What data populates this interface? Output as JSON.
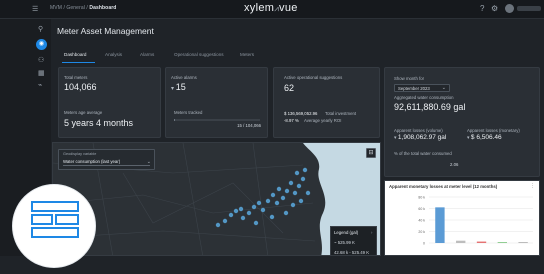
{
  "topbar": {
    "menu_icon": "hamburger-icon",
    "breadcrumb": {
      "prefix": "MVM / General / ",
      "current": "Dashboard"
    },
    "brand": {
      "left": "xylem",
      "right": "vue"
    },
    "icons": [
      "help-icon",
      "gear-icon",
      "user-avatar-icon"
    ]
  },
  "sidebar": {
    "items": [
      {
        "icon": "location-pin-icon"
      },
      {
        "icon": "dashboard-icon",
        "active": true
      },
      {
        "icon": "users-icon"
      },
      {
        "icon": "grid-icon"
      },
      {
        "icon": "analytics-icon"
      }
    ]
  },
  "page": {
    "title": "Meter Asset Management"
  },
  "tabs": [
    {
      "label": "Dashboard",
      "active": true
    },
    {
      "label": "Analysis"
    },
    {
      "label": "Alarms"
    },
    {
      "label": "Operational suggestions"
    },
    {
      "label": "Meters"
    }
  ],
  "cards": {
    "meters": {
      "total_label": "Total meters",
      "total_value": "104,066",
      "age_label": "Meters age average",
      "age_value": "5 years 4 months"
    },
    "alarms": {
      "label": "Active alarms",
      "value": "15",
      "tracked_label": "Meters tracked",
      "tracked_value": "15 / 104,066",
      "tracked_fraction": 0.00014
    },
    "suggestions": {
      "label": "Active operational suggestions",
      "value": "62",
      "investment_value": "$ 136,569,052.96",
      "investment_label": "Total investment",
      "roi_value": "-8.97 %",
      "roi_label": "Average yearly ROI"
    },
    "consumption": {
      "month_label": "Show month for",
      "month_value": "September 2023",
      "aggregated_label": "Aggregated water consumption",
      "aggregated_value": "92,611,880.69 gal",
      "losses_volume_label": "Apparent losses (volume)",
      "losses_volume_value": "1,908,062.97 gal",
      "losses_money_label": "Apparent losses (monetary)",
      "losses_money_value": "$ 6,506.46",
      "pct_label": "% of the total water consumed",
      "pct_value": "2.06"
    }
  },
  "map": {
    "layer_label": "Geodisplay variable",
    "layer_value": "Water consumption (last year)",
    "legend_title": "Legend (gal)",
    "legend_items": [
      "~ 525.99 K",
      "42.68 k - 525.49 K"
    ]
  },
  "chart_data": {
    "type": "bar",
    "title": "Apparent monetary losses at meter level (12 months)",
    "y_ticks": [
      "80 k",
      "60 k",
      "40 k",
      "20 k",
      "0"
    ],
    "ylim": [
      0,
      80000
    ],
    "values": [
      62000,
      4000,
      2500,
      1500,
      1200
    ],
    "colors": [
      "#5b9bd5",
      "#bdbdbd",
      "#e57373",
      "#81c784",
      "#9e9e9e"
    ]
  },
  "overlay": {
    "icon": "brick-wall-icon"
  }
}
